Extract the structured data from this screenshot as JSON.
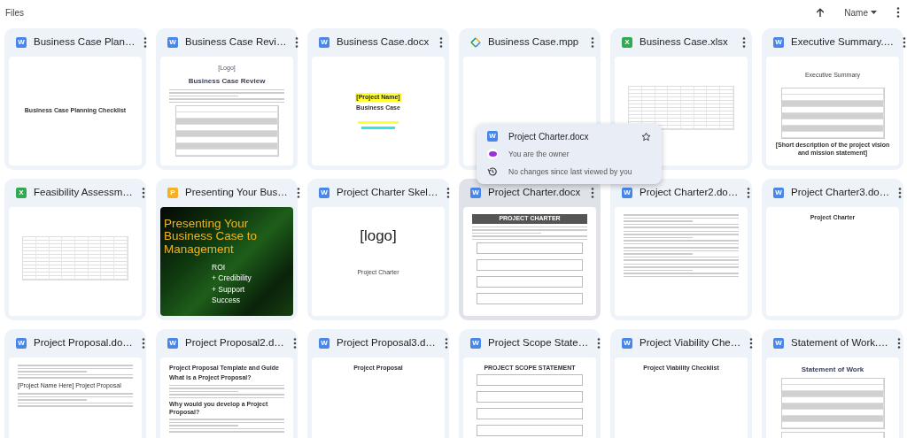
{
  "header": {
    "title": "Files",
    "sort_label": "Name"
  },
  "files": [
    {
      "name": "Business Case Plan…",
      "kind": "docx",
      "badge": "W",
      "hovered": false,
      "preview": {
        "kind": "centered-page",
        "blocks": [
          {
            "kind": "heading",
            "text": "Business Case Planning Checklist"
          }
        ]
      }
    },
    {
      "name": "Business Case Revi…",
      "kind": "docx",
      "badge": "W",
      "hovered": false,
      "preview": {
        "kind": "page",
        "blocks": [
          {
            "kind": "subtle",
            "text": "[Logo]"
          },
          {
            "kind": "title",
            "text": "Business Case Review"
          },
          {
            "kind": "lines"
          },
          {
            "kind": "table"
          }
        ]
      }
    },
    {
      "name": "Business Case.docx",
      "kind": "docx",
      "badge": "W",
      "hovered": false,
      "preview": {
        "kind": "centered-page",
        "blocks": [
          {
            "kind": "highlight",
            "text": "[Project Name]"
          },
          {
            "kind": "heading",
            "text": "Business Case"
          },
          {
            "kind": "bars"
          }
        ]
      }
    },
    {
      "name": "Business Case.mpp",
      "kind": "mpp",
      "hovered": false,
      "preview": {
        "kind": "page"
      }
    },
    {
      "name": "Business Case.xlsx",
      "kind": "xlsx",
      "badge": "X",
      "hovered": false,
      "preview": {
        "kind": "page",
        "blocks": [
          {
            "kind": "sheet"
          }
        ]
      }
    },
    {
      "name": "Executive Summary.…",
      "kind": "docx",
      "badge": "W",
      "hovered": false,
      "preview": {
        "kind": "centered-page",
        "blocks": [
          {
            "kind": "caption",
            "text": "Executive Summary"
          },
          {
            "kind": "table"
          },
          {
            "kind": "heading",
            "text": "[Short description of the project vision and mission statement]"
          }
        ]
      }
    },
    {
      "name": "Feasibility Assessm…",
      "kind": "xlsx",
      "badge": "X",
      "hovered": false,
      "preview": {
        "kind": "page",
        "blocks": [
          {
            "kind": "sheet"
          }
        ]
      }
    },
    {
      "name": "Presenting Your Bus…",
      "kind": "pptx",
      "badge": "P",
      "hovered": false,
      "preview": {
        "kind": "slide",
        "blocks": [
          {
            "kind": "slide-title",
            "text": "Presenting Your Business Case to Management"
          },
          {
            "kind": "bullet",
            "text": "ROI"
          },
          {
            "kind": "bullet",
            "text": "+ Credibility"
          },
          {
            "kind": "bullet",
            "text": "+ Support"
          },
          {
            "kind": "bullet",
            "text": "Success"
          }
        ]
      }
    },
    {
      "name": "Project Charter Skel…",
      "kind": "docx",
      "badge": "W",
      "hovered": false,
      "preview": {
        "kind": "page",
        "blocks": [
          {
            "kind": "logo",
            "text": "[logo]"
          },
          {
            "kind": "caption",
            "text": "Project Charter"
          }
        ]
      }
    },
    {
      "name": "Project Charter.docx",
      "kind": "docx",
      "badge": "W",
      "hovered": true,
      "preview": {
        "kind": "page",
        "blocks": [
          {
            "kind": "banner",
            "text": "PROJECT CHARTER"
          },
          {
            "kind": "lines"
          },
          {
            "kind": "boxes"
          }
        ]
      }
    },
    {
      "name": "Project Charter2.do…",
      "kind": "docx",
      "badge": "W",
      "hovered": false,
      "preview": {
        "kind": "page",
        "blocks": [
          {
            "kind": "lines"
          },
          {
            "kind": "lines"
          },
          {
            "kind": "lines"
          },
          {
            "kind": "lines"
          }
        ]
      }
    },
    {
      "name": "Project Charter3.do…",
      "kind": "docx",
      "badge": "W",
      "hovered": false,
      "preview": {
        "kind": "page",
        "blocks": [
          {
            "kind": "heading",
            "text": "Project Charter"
          }
        ]
      }
    },
    {
      "name": "Project Proposal.do…",
      "kind": "docx",
      "badge": "W",
      "hovered": false,
      "preview": {
        "kind": "page",
        "blocks": [
          {
            "kind": "lines"
          },
          {
            "kind": "left",
            "text": "[Project Name Here] Project Proposal"
          },
          {
            "kind": "lines"
          }
        ]
      }
    },
    {
      "name": "Project Proposal2.d…",
      "kind": "docx",
      "badge": "W",
      "hovered": false,
      "preview": {
        "kind": "page",
        "blocks": [
          {
            "kind": "left-bold",
            "text": "Project Proposal Template and Guide"
          },
          {
            "kind": "left-bold",
            "text": "What is a Project Proposal?"
          },
          {
            "kind": "lines"
          },
          {
            "kind": "left-bold",
            "text": "Why would you develop a Project Proposal?"
          },
          {
            "kind": "lines"
          }
        ]
      }
    },
    {
      "name": "Project Proposal3.d…",
      "kind": "docx",
      "badge": "W",
      "hovered": false,
      "preview": {
        "kind": "page",
        "blocks": [
          {
            "kind": "heading",
            "text": "Project Proposal"
          }
        ]
      }
    },
    {
      "name": "Project Scope State…",
      "kind": "docx",
      "badge": "W",
      "hovered": false,
      "preview": {
        "kind": "page",
        "blocks": [
          {
            "kind": "heading",
            "text": "PROJECT SCOPE STATEMENT"
          },
          {
            "kind": "boxes"
          }
        ]
      }
    },
    {
      "name": "Project Viability Che…",
      "kind": "docx",
      "badge": "W",
      "hovered": false,
      "preview": {
        "kind": "page",
        "blocks": [
          {
            "kind": "heading",
            "text": "Project Viability Checklist"
          }
        ]
      }
    },
    {
      "name": "Statement of Work.…",
      "kind": "docx",
      "badge": "W",
      "hovered": false,
      "preview": {
        "kind": "page",
        "blocks": [
          {
            "kind": "title",
            "text": "Statement of Work"
          },
          {
            "kind": "table"
          },
          {
            "kind": "table"
          }
        ]
      }
    }
  ],
  "hover_card": {
    "name": "Project Charter.docx",
    "kind": "docx",
    "badge": "W",
    "owner": "You are the owner",
    "activity": "No changes since last viewed by you"
  }
}
